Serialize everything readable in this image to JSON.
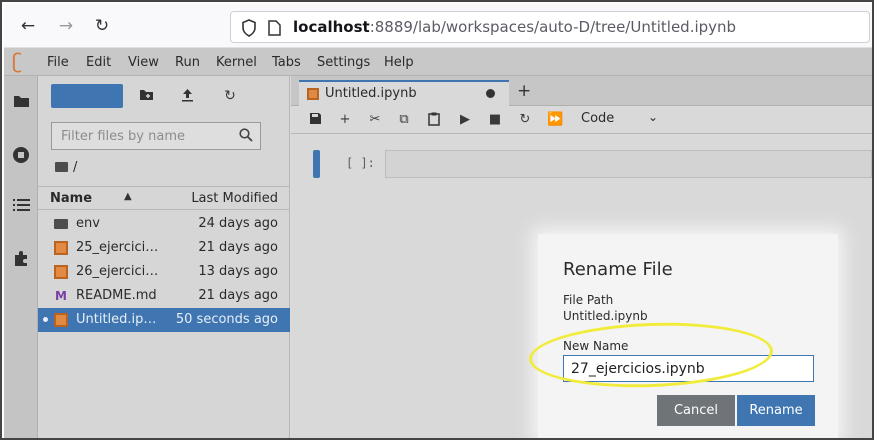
{
  "browser": {
    "back_icon": "←",
    "forward_icon": "→",
    "reload_icon": "↻",
    "url_host": "localhost",
    "url_rest": ":8889/lab/workspaces/auto-D/tree/Untitled.ipynb"
  },
  "menu": [
    "File",
    "Edit",
    "View",
    "Run",
    "Kernel",
    "Tabs",
    "Settings",
    "Help"
  ],
  "filebrowser": {
    "filter_placeholder": "Filter files by name",
    "breadcrumb": "/",
    "col_name": "Name",
    "col_sort": "▲",
    "col_modified": "Last Modified",
    "files": [
      {
        "name": "env",
        "modified": "24 days ago",
        "type": "folder"
      },
      {
        "name": "25_ejercici…",
        "modified": "21 days ago",
        "type": "notebook"
      },
      {
        "name": "26_ejercici…",
        "modified": "13 days ago",
        "type": "notebook"
      },
      {
        "name": "README.md",
        "modified": "21 days ago",
        "type": "markdown"
      },
      {
        "name": "Untitled.ip…",
        "modified": "50 seconds ago",
        "type": "notebook",
        "selected": true
      }
    ]
  },
  "notebook": {
    "tab_label": "Untitled.ipynb",
    "cell_type": "Code",
    "cell_prompt": "[ ]:"
  },
  "dialog": {
    "title": "Rename File",
    "path_label": "File Path",
    "path_value": "Untitled.ipynb",
    "name_label": "New Name",
    "name_value": "27_ejercicios.ipynb",
    "cancel_label": "Cancel",
    "rename_label": "Rename"
  },
  "colors": {
    "accent": "#3f75b1",
    "highlight": "#f1ec3c",
    "cancel": "#6e7478"
  }
}
